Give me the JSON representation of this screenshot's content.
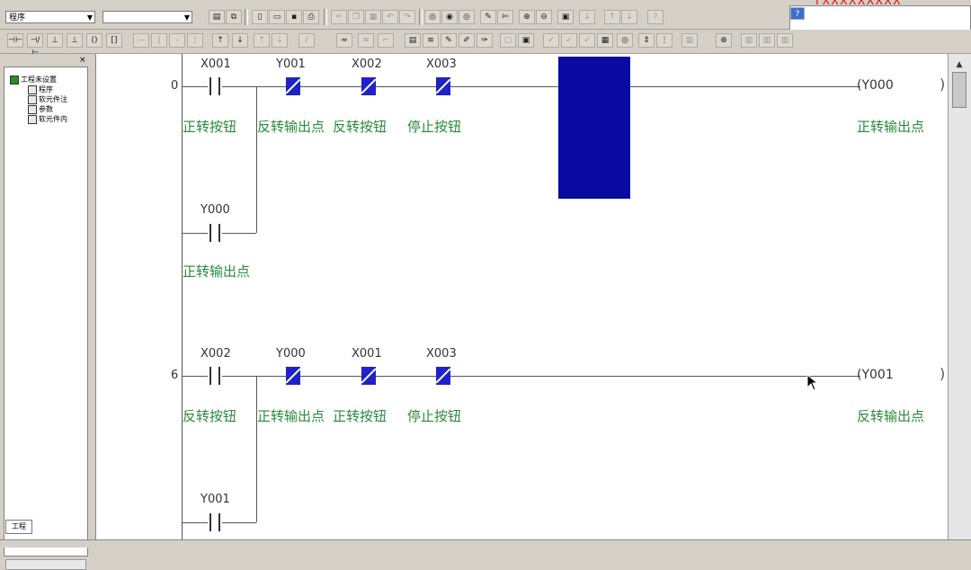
{
  "toolbar": {
    "combo_left": "程序",
    "combo_right": "",
    "red_text": "TXXXXXXXXX"
  },
  "tree": {
    "items": [
      {
        "label": "工程未设置"
      },
      {
        "label": "程序"
      },
      {
        "label": "软元件注"
      },
      {
        "label": "参数"
      },
      {
        "label": "软元件内"
      }
    ],
    "tab": "工程"
  },
  "ladder": {
    "rungs": [
      {
        "step": "0",
        "contacts": [
          {
            "device": "X001",
            "comment": "正转按钮"
          },
          {
            "device": "Y001",
            "comment": "反转输出点"
          },
          {
            "device": "X002",
            "comment": "反转按钮"
          },
          {
            "device": "X003",
            "comment": "停止按钮"
          }
        ],
        "branch": {
          "device": "Y000",
          "comment": "正转输出点"
        },
        "coil": {
          "device": "(Y000",
          "comment": "正转输出点"
        }
      },
      {
        "step": "6",
        "contacts": [
          {
            "device": "X002",
            "comment": "反转按钮"
          },
          {
            "device": "Y000",
            "comment": "正转输出点"
          },
          {
            "device": "X001",
            "comment": "正转按钮"
          },
          {
            "device": "X003",
            "comment": "停止按钮"
          }
        ],
        "branch": {
          "device": "Y001",
          "comment": ""
        },
        "coil": {
          "device": "(Y001",
          "comment": "反转输出点"
        }
      }
    ]
  },
  "colors": {
    "nc_contact": "#1e22c8",
    "comment": "#2a8a3a",
    "cursor": "#0a0aa0"
  }
}
